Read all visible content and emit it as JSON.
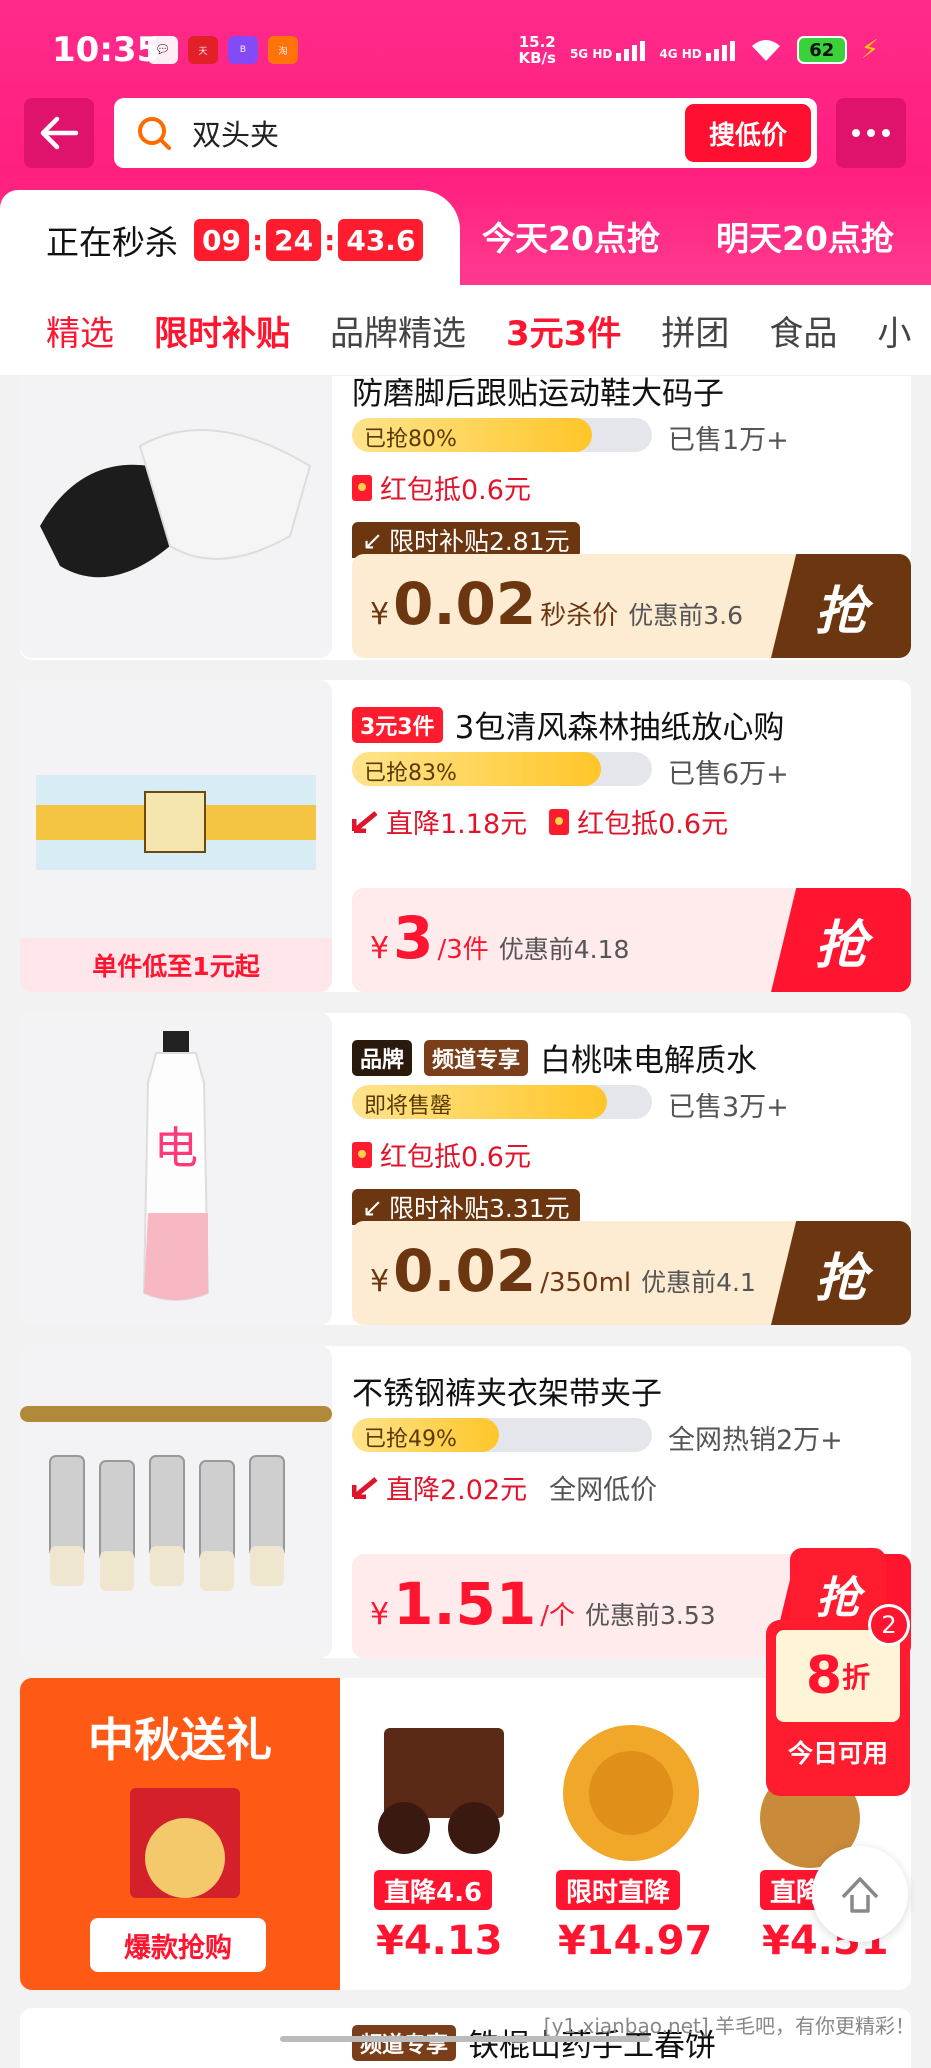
{
  "status_bar": {
    "time": "10:35",
    "net_speed_top": "15.2",
    "net_speed_bottom": "KB/s",
    "sig1": "5G HD",
    "sig2": "4G HD",
    "battery": "62"
  },
  "search": {
    "query": "双头夹",
    "button": "搜低价"
  },
  "tabs": {
    "active_label": "正在秒杀",
    "countdown": [
      "09",
      "24",
      "43.6"
    ],
    "tab2": "今天20点抢",
    "tab3": "明天20点抢"
  },
  "categories": [
    "精选",
    "限时补贴",
    "品牌精选",
    "3元3件",
    "拼团",
    "食品",
    "小"
  ],
  "products": [
    {
      "title": "防磨脚后跟贴运动鞋大码子",
      "progress_label": "已抢80%",
      "progress": 0.8,
      "sold": "已售1万+",
      "perk": "红包抵0.6元",
      "subsidy": "限时补贴2.81元",
      "currency": "¥",
      "price": "0.02",
      "unit": "秒杀价",
      "orig": "优惠前3.6",
      "grab": "抢"
    },
    {
      "tag": "3元3件",
      "title": "3包清风森林抽纸放心购",
      "progress_label": "已抢83%",
      "progress": 0.83,
      "sold": "已售6万+",
      "perk1": "直降1.18元",
      "perk2": "红包抵0.6元",
      "img_caption": "单件低至1元起",
      "currency": "¥",
      "price": "3",
      "unit": "/3件",
      "orig": "优惠前4.18",
      "grab": "抢"
    },
    {
      "tag1": "品牌",
      "tag2": "频道专享",
      "title": "白桃味电解质水",
      "progress_label": "即将售罄",
      "progress": 0.85,
      "sold": "已售3万+",
      "perk": "红包抵0.6元",
      "subsidy": "限时补贴3.31元",
      "currency": "¥",
      "price": "0.02",
      "unit": "/350ml",
      "orig": "优惠前4.1",
      "grab": "抢"
    },
    {
      "title": "不锈钢裤夹衣架带夹子",
      "progress_label": "已抢49%",
      "progress": 0.49,
      "sold": "全网热销2万+",
      "perk1": "直降2.02元",
      "perk2": "全网低价",
      "currency": "¥",
      "price": "1.51",
      "unit": "/个",
      "orig": "优惠前3.53",
      "grab": "抢"
    }
  ],
  "festival": {
    "title": "中秋送礼",
    "button": "爆款抢购",
    "items": [
      {
        "tag": "直降4.6",
        "price": "¥4.13"
      },
      {
        "tag": "限时直降",
        "price": "¥14.97"
      },
      {
        "tag": "直降",
        "price": "¥4.51"
      }
    ]
  },
  "coupon": {
    "value": "8",
    "suffix": "折",
    "label": "今日可用",
    "badge": "2",
    "top": "抢"
  },
  "bottom_product": {
    "tag": "频道专享",
    "title": "铁棍山药手工春饼"
  },
  "watermark": "[y1.xianbao.net] 羊毛吧，有你更精彩！",
  "colors": {
    "brand": "#ff1f7e",
    "accent": "#ff1530",
    "brown": "#6b3610"
  }
}
